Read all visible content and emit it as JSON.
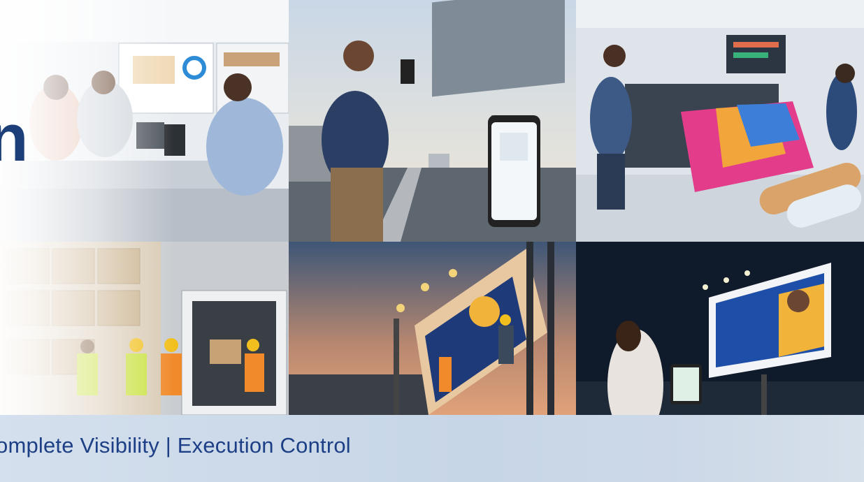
{
  "hero": {
    "tagline": "omplete Visibility | Execution Control",
    "partial_headline": "n"
  },
  "panels": [
    {
      "id": "office-meeting",
      "subject": "team meeting with analytics dashboards"
    },
    {
      "id": "billboard-survey",
      "subject": "worker photographing blank billboard with phone"
    },
    {
      "id": "print-facility",
      "subject": "large-format printing of banners"
    },
    {
      "id": "warehouse-loading",
      "subject": "workers loading boxes into truck"
    },
    {
      "id": "billboard-install",
      "subject": "installers mounting billboard at dusk"
    },
    {
      "id": "night-billboard",
      "subject": "woman checking tablet near lit billboard"
    }
  ],
  "colors": {
    "brand_blue": "#1d3f86",
    "bar": "#c8d7e8"
  }
}
